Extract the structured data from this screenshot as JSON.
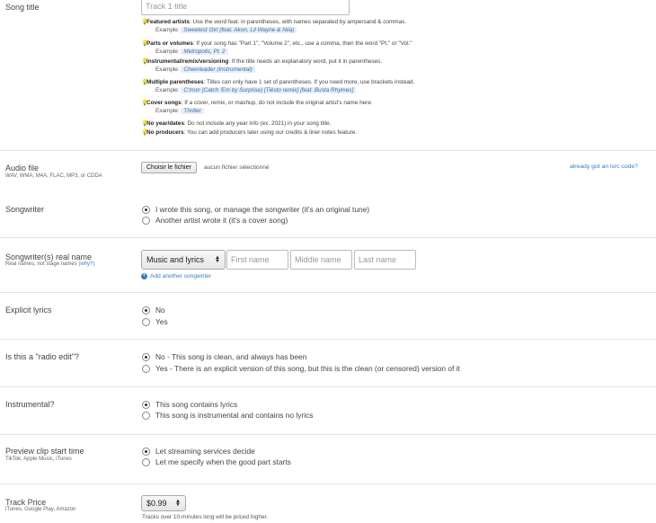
{
  "song_title": {
    "label": "Song title",
    "placeholder": "Track 1 title",
    "tips": [
      {
        "bold": "Featured artists",
        "text": ": Use the word feat. in parentheses, with names separated by ampersand & commas.",
        "example_prefix": "Example:",
        "example": "Sweetest Girl (feat. Akon, Lil Wayne & Niia)"
      },
      {
        "bold": "Parts or volumes",
        "text": ": If your song has \"Part 1\", \"Volume 2\", etc., use a comma, then the word \"Pt.\" or \"Vol.\"",
        "example_prefix": "Example:",
        "example": "Metropolis, Pt. 2"
      },
      {
        "bold": "Instrumental/remix/versioning",
        "text": ": If the title needs an explanatory word, put it in parentheses.",
        "example_prefix": "Example:",
        "example": "Cheerleader (Instrumental)"
      },
      {
        "bold": "Multiple parentheses",
        "text": ": Titles can only have 1 set of parentheses. If you need more, use brackets instead.",
        "example_prefix": "Example:",
        "example": "C'mon (Catch 'Em by Surprise) [Tiësto remix] [feat. Busta Rhymes]"
      },
      {
        "bold": "Cover songs",
        "text": ": If a cover, remix, or mashup, do not include the original artist's name here.",
        "example_prefix": "Example:",
        "example": "Thriller"
      },
      {
        "bold": "No year/dates",
        "text": ": Do not include any year info (ex. 2021) in your song title."
      },
      {
        "bold": "No producers",
        "text": ": You can add producers later using our credits & liner notes feature."
      }
    ]
  },
  "audio": {
    "label": "Audio file",
    "sub": "WAV, WMA, M4A, FLAC, MP3, or CDDA",
    "button": "Choisir le fichier",
    "status": "aucun fichier sélectionné",
    "isrc_link": "already got an isrc code?"
  },
  "songwriter": {
    "label": "Songwriter",
    "options": [
      "I wrote this song, or manage the songwriter (it's an original tune)",
      "Another artist wrote it (it's a cover song)"
    ]
  },
  "real_name": {
    "label": "Songwriter(s) real name",
    "sub": "Real names, not stage names ",
    "why": "(why?)",
    "role": "Music and lyrics",
    "first": "First name",
    "middle": "Middle name",
    "last": "Last name",
    "add": "Add another songwriter"
  },
  "explicit": {
    "label": "Explicit lyrics",
    "options": [
      "No",
      "Yes"
    ]
  },
  "radio_edit": {
    "label": "Is this a \"radio edit\"?",
    "options": [
      "No - This song is clean, and always has been",
      "Yes - There is an explicit version of this song, but this is the clean (or censored) version of it"
    ]
  },
  "instrumental": {
    "label": "Instrumental?",
    "options": [
      "This song contains lyrics",
      "This song is instrumental and contains no lyrics"
    ]
  },
  "preview": {
    "label": "Preview clip start time",
    "sub": "TikTok, Apple Music, iTunes",
    "options": [
      "Let streaming services decide",
      "Let me specify when the good part starts"
    ]
  },
  "price": {
    "label": "Track Price",
    "sub": "iTunes, Google Play, Amazon",
    "value": "$0.99",
    "note": "Tracks over 10-minutes long will be priced higher."
  }
}
